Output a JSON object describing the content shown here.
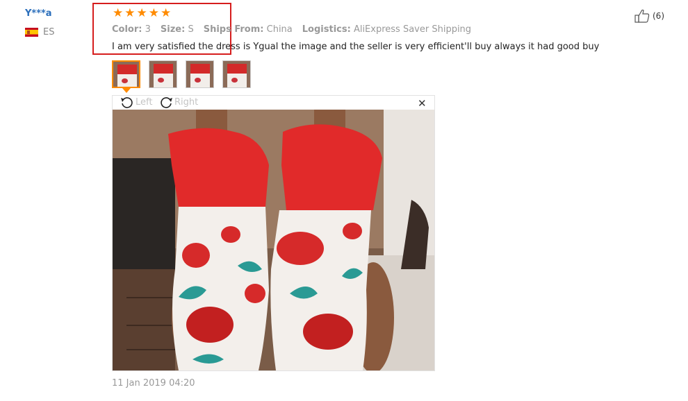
{
  "reviewer": {
    "name": "Y***a",
    "country_code": "ES",
    "flag_icon": "spain-flag-icon"
  },
  "rating": {
    "stars": 5,
    "max": 5,
    "color": "#ff8b00"
  },
  "attributes": [
    {
      "label": "Color:",
      "value": "3"
    },
    {
      "label": "Size:",
      "value": "S"
    },
    {
      "label": "Ships From:",
      "value": "China"
    },
    {
      "label": "Logistics:",
      "value": "AliExpress Saver Shipping"
    }
  ],
  "review_text": "I am very satisfied the dress is Ygual the image and the seller is very efficient'll buy always it had good buy",
  "thumbnails": {
    "count": 4,
    "active_index": 0
  },
  "viewer": {
    "rotate_left_label": "Left",
    "rotate_right_label": "Right",
    "close_label": "✕"
  },
  "date": "11 Jan 2019 04:20",
  "helpful": {
    "count": "(6)",
    "icon": "thumbs-up-icon"
  },
  "colors": {
    "username": "#2a6ebb",
    "highlight_box": "#d61d1d",
    "star": "#ff8b00"
  }
}
